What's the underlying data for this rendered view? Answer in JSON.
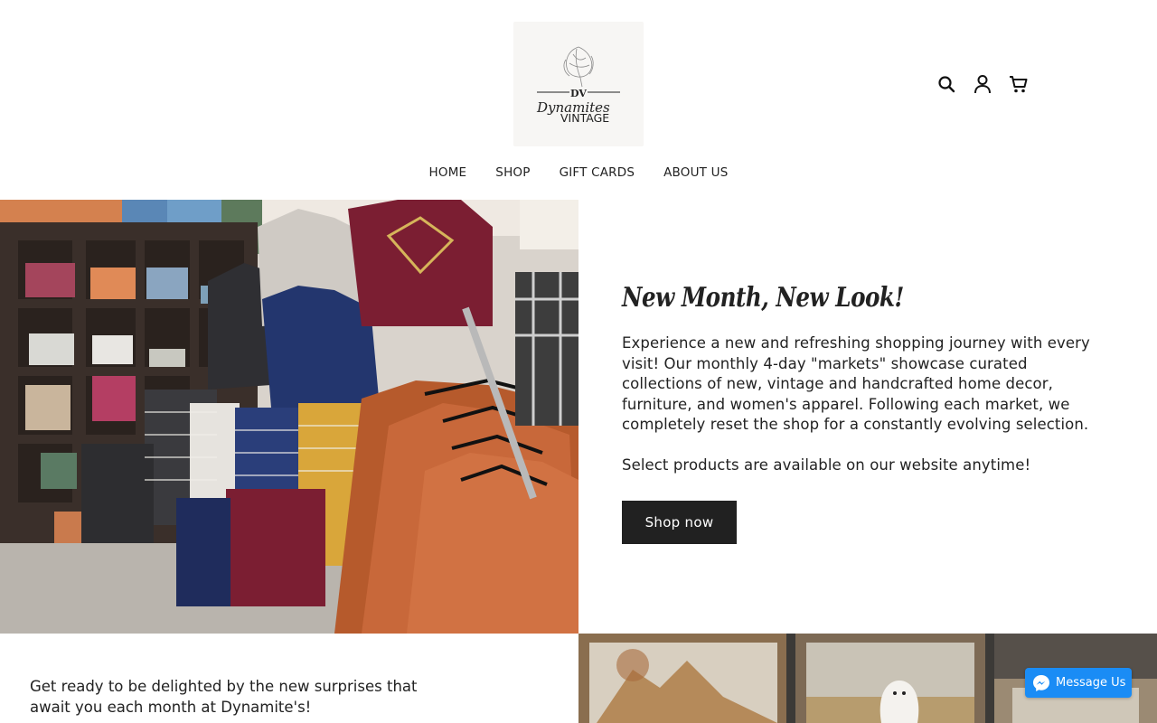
{
  "brand": {
    "monogram": "DV",
    "name_line1": "Dynamites",
    "name_line2": "VINTAGE"
  },
  "header": {
    "icons": [
      "search-icon",
      "account-icon",
      "cart-icon"
    ]
  },
  "nav": {
    "items": [
      "HOME",
      "SHOP",
      "GIFT CARDS",
      "ABOUT US"
    ]
  },
  "hero": {
    "title": "New Month, New Look!",
    "paragraph1": "Experience a new and refreshing shopping journey with every visit! Our monthly 4-day \"markets\" showcase curated collections of new, vintage and handcrafted home decor, furniture, and women's apparel. Following each market, we completely reset the shop for a constantly evolving selection.",
    "paragraph2": "Select products are available on our website anytime!",
    "cta": "Shop now"
  },
  "lower": {
    "text": "Get ready to be delighted by the new surprises that await you each month at Dynamite's!"
  },
  "messenger": {
    "label": "Message Us"
  },
  "colors": {
    "button_dark": "#212121",
    "messenger_blue": "#1a8cf5"
  }
}
